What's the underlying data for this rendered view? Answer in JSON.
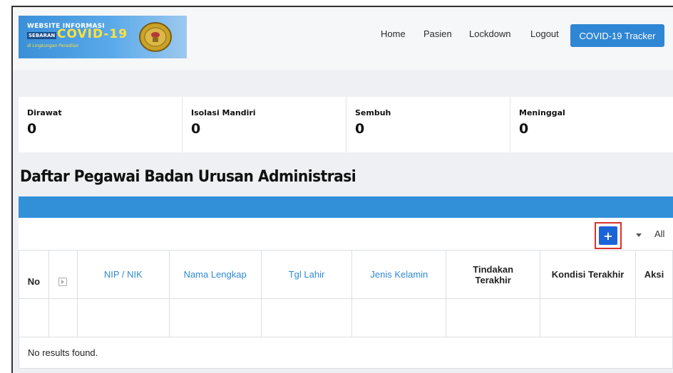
{
  "header": {
    "logo": {
      "line1": "WEBSITE INFORMASI",
      "line2": "SEBARAN",
      "line3": "COVID-19",
      "line4": "di Lingkungan Peradilan"
    },
    "nav": [
      "Home",
      "Pasien",
      "Lockdown",
      "Logout"
    ],
    "tracker_button": "COVID-19 Tracker"
  },
  "stats": [
    {
      "label": "Dirawat",
      "value": "0"
    },
    {
      "label": "Isolasi Mandiri",
      "value": "0"
    },
    {
      "label": "Sembuh",
      "value": "0"
    },
    {
      "label": "Meninggal",
      "value": "0"
    }
  ],
  "page_title": "Daftar Pegawai Badan Urusan Administrasi",
  "toolbar": {
    "add_label": "+",
    "page_size": "All"
  },
  "table": {
    "columns": [
      "No",
      "",
      "NIP / NIK",
      "Nama Lengkap",
      "Tgl Lahir",
      "Jenis Kelamin",
      "Tindakan Terakhir",
      "Kondisi Terakhir",
      "Aksi"
    ],
    "empty_text": "No results found."
  },
  "colors": {
    "accent": "#2f86d4",
    "header_bar": "#3290d9",
    "add_button": "#1d63d8",
    "highlight": "#d8322b"
  }
}
